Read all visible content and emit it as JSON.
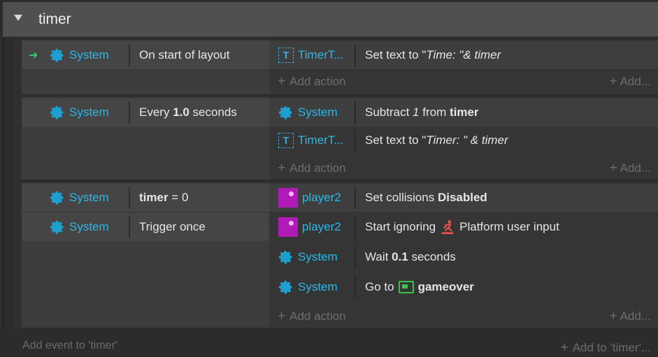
{
  "group": {
    "title": "timer"
  },
  "events": [
    {
      "conditions": [
        {
          "object": "System",
          "text": "On start of layout",
          "trigger": true
        }
      ],
      "actions": [
        {
          "object": "TimerT...",
          "icon": "text-object-icon",
          "parts": [
            "Set text to \"",
            "Time: \"& timer"
          ]
        }
      ],
      "add_action": "Add action",
      "add_right": "Add..."
    },
    {
      "conditions": [
        {
          "object": "System",
          "pre": "Every ",
          "bold": "1.0",
          "post": " seconds"
        }
      ],
      "actions": [
        {
          "object": "System",
          "icon": "gear-icon",
          "pre": "Subtract ",
          "italic": "1",
          "mid": " from ",
          "bold": "timer"
        },
        {
          "object": "TimerT...",
          "icon": "text-object-icon",
          "pre": "Set text to \"",
          "italic": "Timer: \" & timer"
        }
      ],
      "add_action": "Add action",
      "add_right": "Add..."
    },
    {
      "conditions": [
        {
          "object": "System",
          "bold": "timer",
          "post": " = 0"
        },
        {
          "object": "System",
          "text": "Trigger once"
        }
      ],
      "actions": [
        {
          "object": "player2",
          "icon": "sprite-icon",
          "pre": "Set collisions ",
          "bold": "Disabled"
        },
        {
          "object": "player2",
          "icon": "sprite-icon",
          "pre": "Start ignoring",
          "post": "Platform user input"
        },
        {
          "object": "System",
          "icon": "gear-icon",
          "pre": "Wait ",
          "bold": "0.1",
          "post": " seconds"
        },
        {
          "object": "System",
          "icon": "gear-icon",
          "pre": "Go to",
          "bold": "gameover"
        }
      ],
      "add_action": "Add action",
      "add_right": "Add..."
    }
  ],
  "footer": {
    "add_event": "Add event to 'timer'",
    "add_to": "Add to 'timer'..."
  },
  "colors": {
    "object_name": "#2bb8e8",
    "trigger_arrow": "#3ec46d",
    "sprite": "#b21ab8",
    "layout_icon": "#39c24d"
  }
}
